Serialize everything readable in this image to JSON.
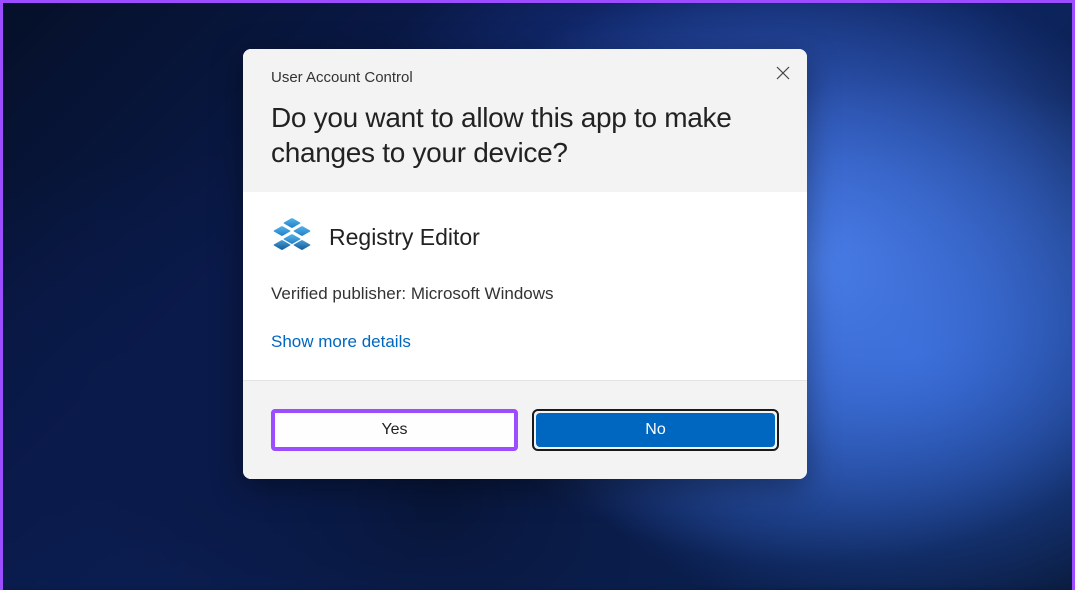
{
  "dialog": {
    "title": "User Account Control",
    "question": "Do you want to allow this app to make changes to your device?",
    "app_name": "Registry Editor",
    "publisher": "Verified publisher: Microsoft Windows",
    "details_link": "Show more details",
    "yes_label": "Yes",
    "no_label": "No"
  },
  "colors": {
    "accent": "#0067c0",
    "highlight": "#9b4dff"
  }
}
